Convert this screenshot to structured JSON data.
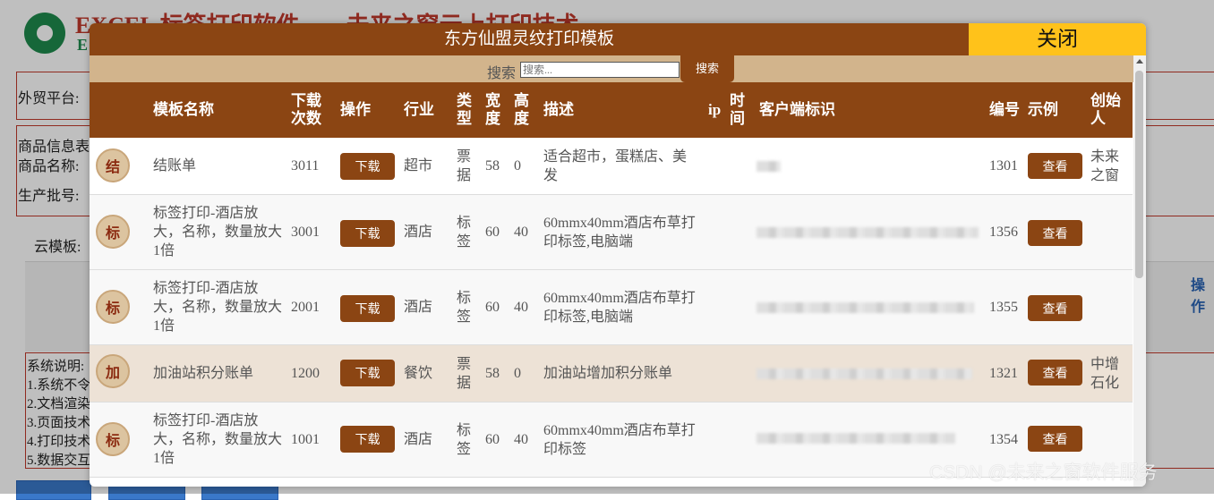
{
  "background": {
    "app_title": "EXCEL 标签打印软件——未来之窗云上打印技术",
    "labels": {
      "platform": "外贸平台:",
      "goods_info": "商品信息表",
      "goods_name": "商品名称:",
      "batch": "生产批号:",
      "cloud_template": "云模板:",
      "system_note": "系统说明:",
      "note1": "1.系统不令",
      "note2": "2.文档渲染",
      "note3": "3.页面技术",
      "note4": "4.打印技术",
      "note5": "5.数据交互",
      "op": "操作"
    }
  },
  "modal": {
    "title": "东方仙盟灵纹打印模板",
    "close_label": "关闭",
    "search_label": "搜索",
    "search_placeholder": "搜索...",
    "search_button": "搜索",
    "columns": {
      "name": "模板名称",
      "downloads": "下载次数",
      "op": "操作",
      "industry": "行业",
      "type": "类型",
      "width": "宽度",
      "height": "高度",
      "desc": "描述",
      "ip": "ip",
      "time": "时间",
      "client_id": "客户端标识",
      "id": "编号",
      "example": "示例",
      "creator": "创始人"
    },
    "rows": [
      {
        "badge": "结",
        "name": "结账单",
        "downloads": "3011",
        "download_btn": "下载",
        "industry": "超市",
        "type": "票据",
        "width": "58",
        "height": "0",
        "desc": "适合超市，蛋糕店、美发",
        "id": "1301",
        "view_btn": "查看",
        "creator": "未来之窗"
      },
      {
        "badge": "标",
        "name": "标签打印-酒店放大，名称，数量放大1倍",
        "downloads": "3001",
        "download_btn": "下载",
        "industry": "酒店",
        "type": "标签",
        "width": "60",
        "height": "40",
        "desc": "60mmx40mm酒店布草打印标签,电脑端",
        "id": "1356",
        "view_btn": "查看",
        "creator": ""
      },
      {
        "badge": "标",
        "name": "标签打印-酒店放大，名称，数量放大1倍",
        "downloads": "2001",
        "download_btn": "下载",
        "industry": "酒店",
        "type": "标签",
        "width": "60",
        "height": "40",
        "desc": "60mmx40mm酒店布草打印标签,电脑端",
        "id": "1355",
        "view_btn": "查看",
        "creator": ""
      },
      {
        "badge": "加",
        "name": "加油站积分账单",
        "downloads": "1200",
        "download_btn": "下载",
        "industry": "餐饮",
        "type": "票据",
        "width": "58",
        "height": "0",
        "desc": "加油站增加积分账单",
        "id": "1321",
        "view_btn": "查看",
        "creator": "中增石化"
      },
      {
        "badge": "标",
        "name": "标签打印-酒店放大，名称，数量放大1倍",
        "downloads": "1001",
        "download_btn": "下载",
        "industry": "酒店",
        "type": "标签",
        "width": "60",
        "height": "40",
        "desc": "60mmx40mm酒店布草打印标签",
        "id": "1354",
        "view_btn": "查看",
        "creator": ""
      }
    ]
  },
  "watermark": "CSDN @未来之窗软件服务"
}
